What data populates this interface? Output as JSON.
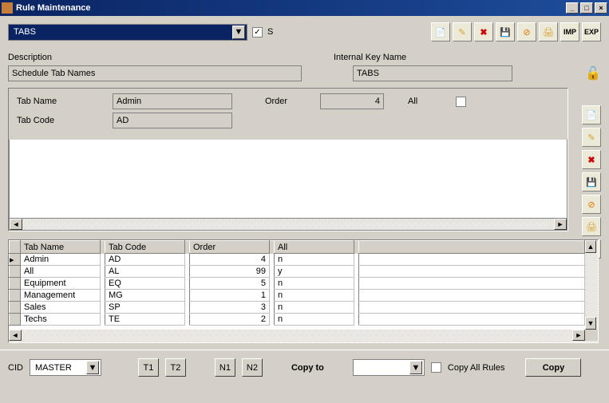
{
  "window": {
    "title": "Rule Maintenance"
  },
  "topbar": {
    "combo_value": "TABS",
    "s_label": "S",
    "s_checked": true,
    "buttons": {
      "imp": "IMP",
      "exp": "EXP"
    }
  },
  "description": {
    "label": "Description",
    "value": "Schedule Tab Names"
  },
  "internal_key": {
    "label": "Internal Key Name",
    "value": "TABS"
  },
  "detail": {
    "tabname_label": "Tab Name",
    "tabname_value": "Admin",
    "order_label": "Order",
    "order_value": "4",
    "all_label": "All",
    "all_checked": false,
    "tabcode_label": "Tab Code",
    "tabcode_value": "AD"
  },
  "grid": {
    "headers": [
      "Tab Name",
      "Tab Code",
      "Order",
      "All"
    ],
    "rows": [
      [
        "Admin",
        "AD",
        "4",
        "n"
      ],
      [
        "All",
        "AL",
        "99",
        "y"
      ],
      [
        "Equipment",
        "EQ",
        "5",
        "n"
      ],
      [
        "Management",
        "MG",
        "1",
        "n"
      ],
      [
        "Sales",
        "SP",
        "3",
        "n"
      ],
      [
        "Techs",
        "TE",
        "2",
        "n"
      ]
    ]
  },
  "bottom": {
    "cid_label": "CID",
    "cid_value": "MASTER",
    "t1": "T1",
    "t2": "T2",
    "n1": "N1",
    "n2": "N2",
    "copy_to_label": "Copy to",
    "copy_to_value": "",
    "copy_all_label": "Copy All Rules",
    "copy_btn": "Copy"
  }
}
